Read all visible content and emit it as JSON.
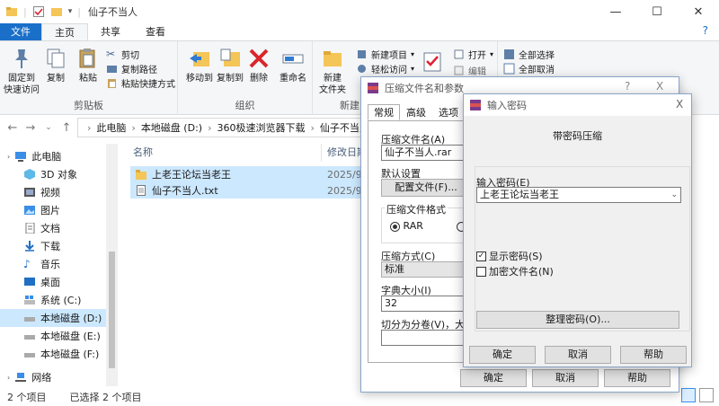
{
  "explorer": {
    "title": "仙子不当人",
    "tabs": [
      "文件",
      "主页",
      "共享",
      "查看"
    ],
    "ribbon": {
      "clipboard": {
        "pin_label": "固定到\n快速访问",
        "copy_label": "复制",
        "paste_label": "粘贴",
        "cut_label": "剪切",
        "copy_path_label": "复制路径",
        "paste_shortcut_label": "粘贴快捷方式",
        "group_label": "剪贴板"
      },
      "organize": {
        "move_to_label": "移动到",
        "copy_to_label": "复制到",
        "delete_label": "删除",
        "rename_label": "重命名",
        "group_label": "组织"
      },
      "new": {
        "new_folder_label": "新建\n文件夹",
        "new_item_label": "新建项目",
        "easy_access_label": "轻松访问",
        "group_label": "新建"
      },
      "open": {
        "properties_label": "属性",
        "open_label": "打开",
        "edit_label": "编辑"
      },
      "select": {
        "select_all_label": "全部选择",
        "select_none_label": "全部取消"
      }
    },
    "breadcrumb": [
      "此电脑",
      "本地磁盘 (D:)",
      "360极速浏览器下载",
      "仙子不当人"
    ],
    "columns": {
      "name": "名称",
      "modified": "修改日期"
    },
    "files": [
      {
        "name": "上老王论坛当老王",
        "date": "2025/9/"
      },
      {
        "name": "仙子不当人.txt",
        "date": "2025/9/"
      }
    ],
    "nav": [
      {
        "label": "此电脑",
        "icon": "pc-icon"
      },
      {
        "label": "3D 对象",
        "icon": "3d-objects-icon"
      },
      {
        "label": "视频",
        "icon": "video-icon"
      },
      {
        "label": "图片",
        "icon": "pictures-icon"
      },
      {
        "label": "文档",
        "icon": "documents-icon"
      },
      {
        "label": "下载",
        "icon": "download-icon"
      },
      {
        "label": "音乐",
        "icon": "music-icon"
      },
      {
        "label": "桌面",
        "icon": "desktop-icon"
      },
      {
        "label": "系统 (C:)",
        "icon": "drive-c-icon"
      },
      {
        "label": "本地磁盘 (D:)",
        "icon": "drive-icon"
      },
      {
        "label": "本地磁盘 (E:)",
        "icon": "drive-icon"
      },
      {
        "label": "本地磁盘 (F:)",
        "icon": "drive-icon"
      },
      {
        "label": "网络",
        "icon": "network-icon"
      }
    ],
    "status": {
      "count": "2 个项目",
      "selected": "已选择 2 个项目"
    }
  },
  "rar_dialog": {
    "title": "压缩文件名和参数",
    "help": "?",
    "close": "X",
    "tabs": [
      "常规",
      "高级",
      "选项"
    ],
    "archive_name_label": "压缩文件名(A)",
    "archive_name_value": "仙子不当人.rar",
    "profile_label": "默认设置",
    "profile_button": "配置文件(F)...",
    "format_label": "压缩文件格式",
    "format_rar": "RAR",
    "method_label": "压缩方式(C)",
    "method_value": "标准",
    "dict_label": "字典大小(I)",
    "dict_value": "32",
    "split_label": "切分为分卷(V)，大小",
    "ok": "确定",
    "cancel": "取消",
    "help_btn": "帮助"
  },
  "password_dialog": {
    "title": "输入密码",
    "close": "X",
    "heading": "带密码压缩",
    "password_label": "输入密码(E)",
    "password_value": "上老王论坛当老王",
    "show_password": "显示密码(S)",
    "encrypt_names": "加密文件名(N)",
    "organize_btn": "整理密码(O)...",
    "ok": "确定",
    "cancel": "取消",
    "help": "帮助"
  },
  "colors": {
    "accent": "#1a6fc9",
    "selection": "#cce8ff",
    "folder": "#f4c557"
  }
}
